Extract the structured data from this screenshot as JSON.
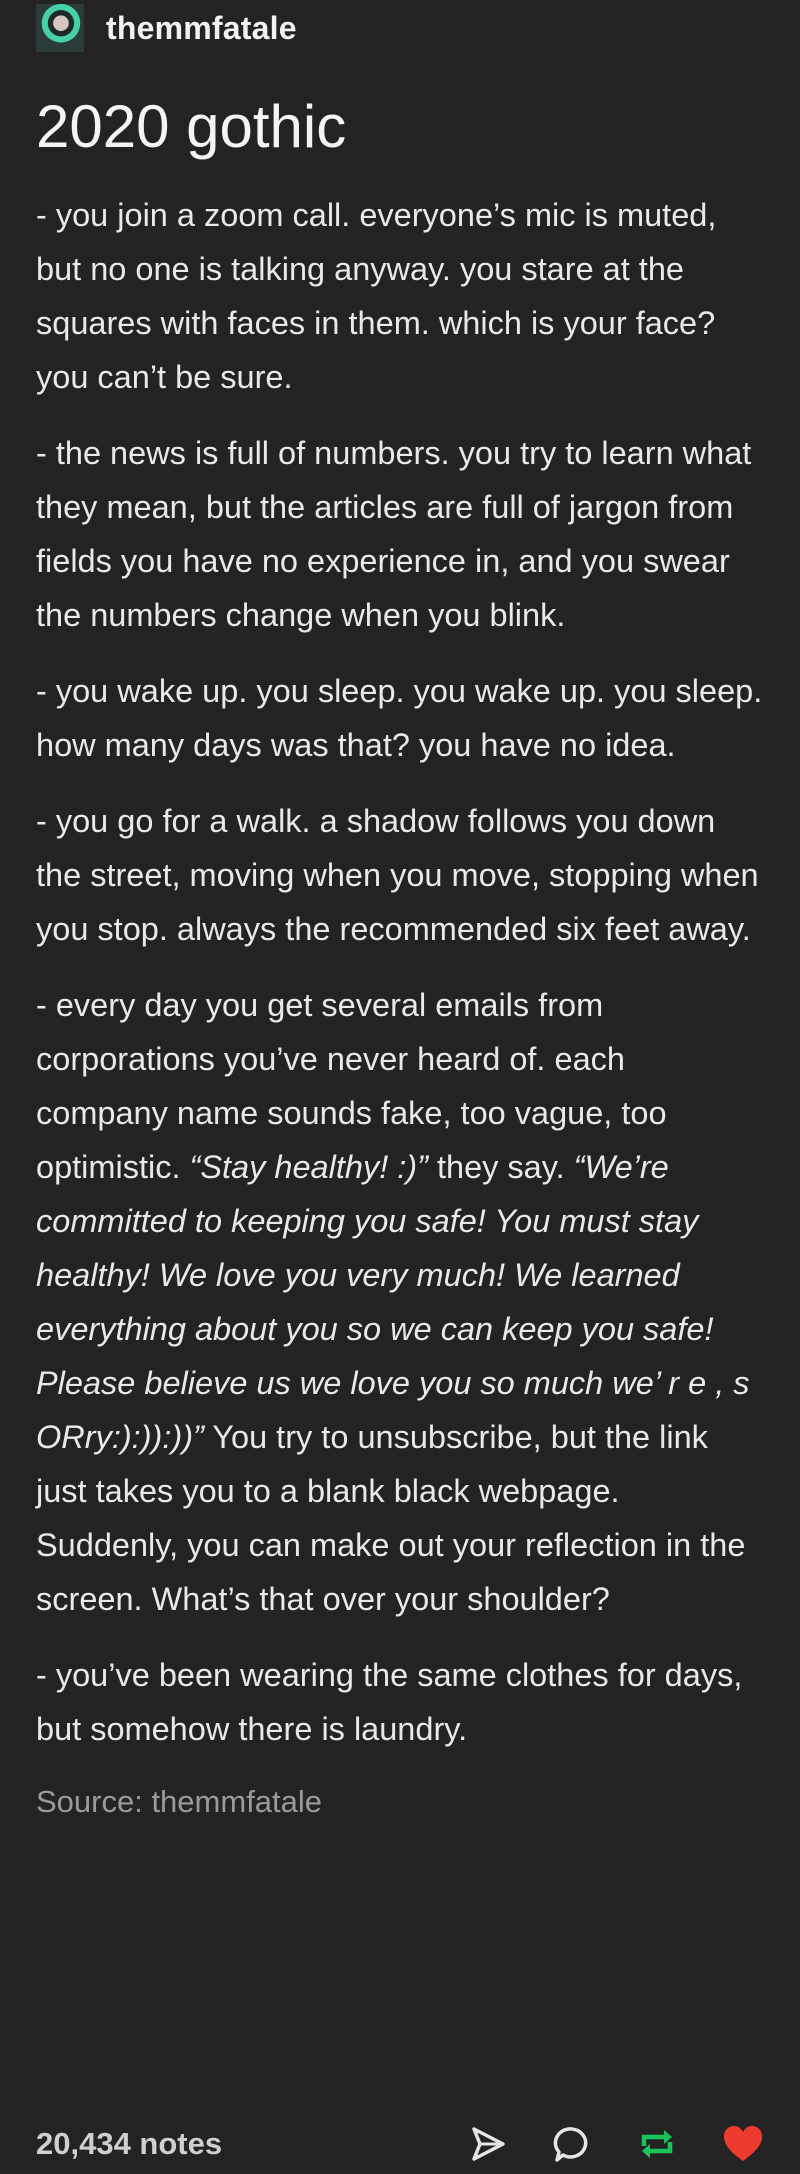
{
  "post": {
    "username": "themmfatale",
    "title": "2020 gothic",
    "paragraphs": [
      {
        "plain": "- you join a zoom call. everyone’s mic is muted, but no one is talking anyway. you stare at the squares with faces in them. which is your face? you can’t be sure."
      },
      {
        "plain": "- the news is full of numbers. you try to learn what they mean, but the articles are full of jargon from fields you have no experience in, and you swear the numbers change when you blink."
      },
      {
        "plain": "- you wake up. you sleep. you wake up. you sleep. how many days was that? you have no idea."
      },
      {
        "plain": "- you go for a walk. a shadow follows you down the street, moving when you move, stopping when you stop. always the recommended six feet away."
      }
    ],
    "emails": {
      "intro": "- every day you get several emails from corporations you’ve never heard of. each company name sounds fake, too vague, too optimistic. ",
      "quote1": "“Stay healthy! :)”",
      "mid": " they say. ",
      "quote2": "“We’re committed to keeping you safe! You must stay healthy! We love you very much! We learned everything about you so we can keep you safe! Please believe us we love you so much we’ r e , s ORry:):)):))”",
      "outro": " You try to unsubscribe, but the link just takes you to a blank black webpage. Suddenly, you can make out your reflection in the screen. What’s that over your shoulder?"
    },
    "last_paragraph": "- you’ve been wearing the same clothes for days, but somehow there is laundry.",
    "source": "Source: themmfatale",
    "notes": "20,434 notes"
  },
  "colors": {
    "background": "#232323",
    "reblog": "#19c35a",
    "like": "#ee3b30"
  },
  "icons": [
    "avatar",
    "share-icon",
    "reply-icon",
    "reblog-icon",
    "like-icon"
  ]
}
